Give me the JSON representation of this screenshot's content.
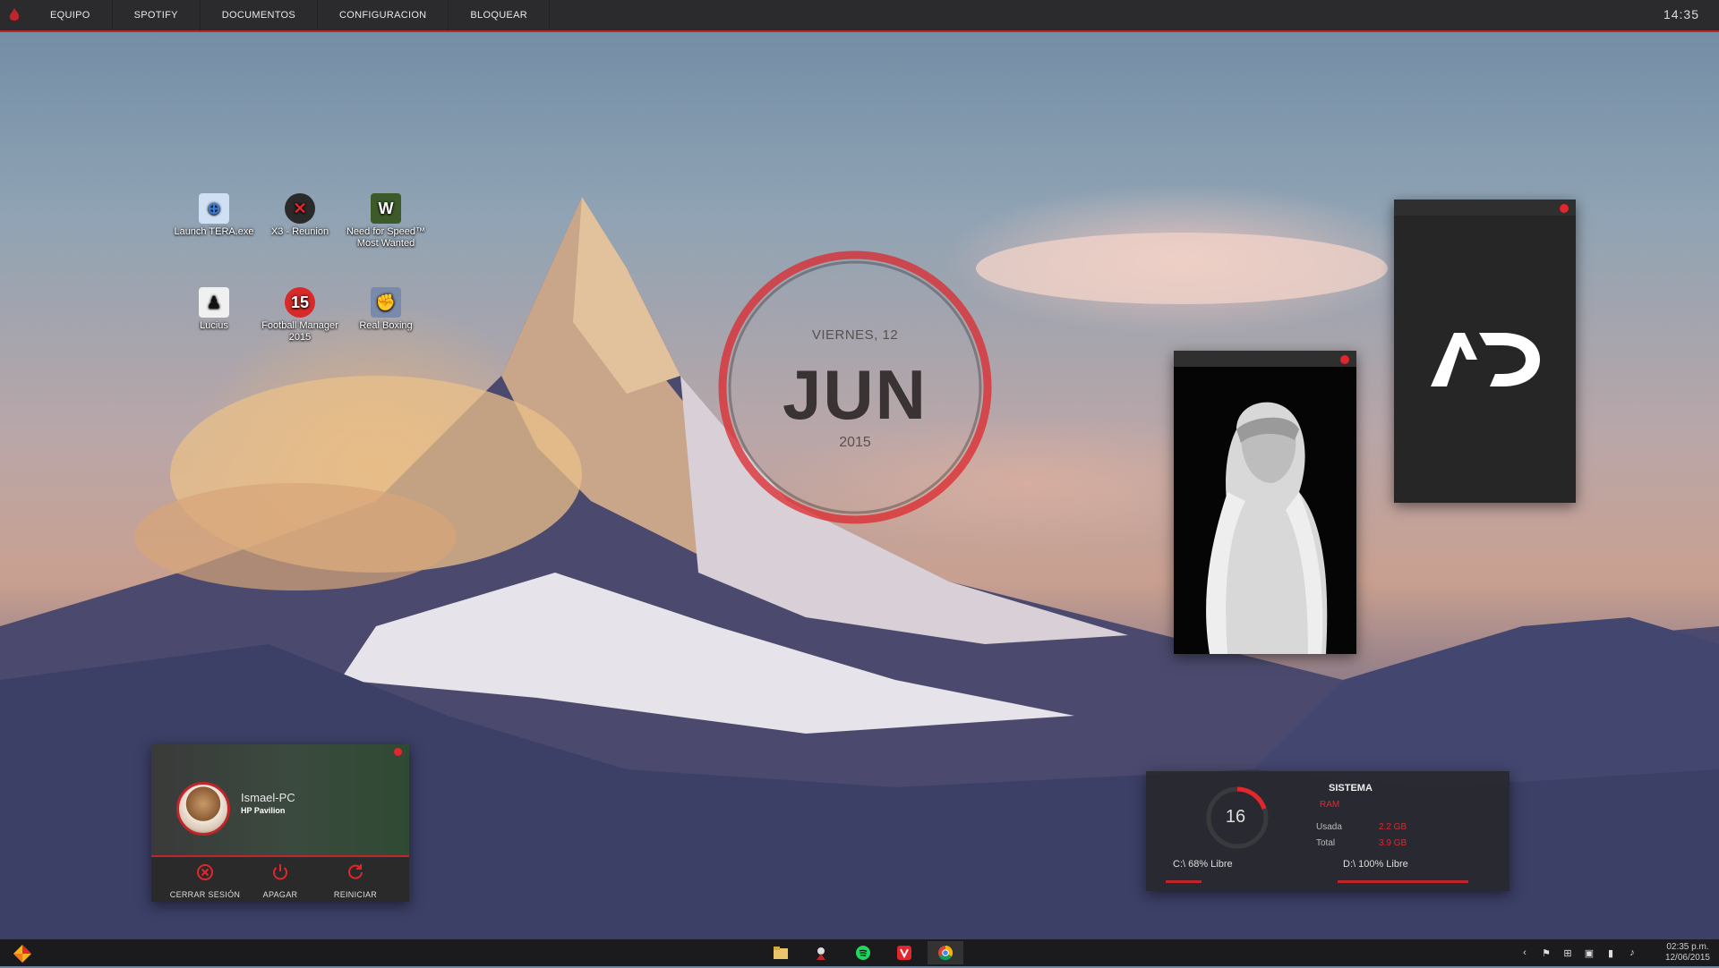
{
  "topbar": {
    "menu": [
      "EQUIPO",
      "SPOTIFY",
      "DOCUMENTOS",
      "CONFIGURACION",
      "BLOQUEAR"
    ],
    "clock": "14:35"
  },
  "desktop_icons": [
    {
      "label": "Launch TERA.exe",
      "icon": "tera-icon",
      "color": "#3a7bd5"
    },
    {
      "label": "X3 - Reunion",
      "icon": "x3-icon",
      "color": "#c0252b"
    },
    {
      "label": "Need for Speed™ Most Wanted",
      "icon": "nfs-icon",
      "color": "#3d5a2a"
    },
    {
      "label": "Lucius",
      "icon": "lucius-icon",
      "color": "#222222"
    },
    {
      "label": "Football Manager 2015",
      "icon": "fm-icon",
      "color": "#d92a2a"
    },
    {
      "label": "Real Boxing",
      "icon": "boxing-icon",
      "color": "#5a6a8a"
    }
  ],
  "date_widget": {
    "day": "VIERNES, 12",
    "month": "JUN",
    "year": "2015"
  },
  "user_widget": {
    "pc_name": "Ismael-PC",
    "model": "HP Pavilion",
    "actions": [
      "CERRAR SESIÓN",
      "APAGAR",
      "REINICIAR"
    ]
  },
  "system_widget": {
    "value": "16",
    "title": "SISTEMA",
    "section": "RAM",
    "used_label": "Usada",
    "used_value": "2.2 GB",
    "total_label": "Total",
    "total_value": "3.9 GB",
    "drive_c": "C:\\ 68% Libre",
    "drive_d": "D:\\ 100% Libre"
  },
  "taskbar": {
    "apps": [
      "file-explorer-icon",
      "media-icon",
      "spotify-icon",
      "vivaldi-icon",
      "chrome-icon"
    ],
    "time": "02:35 p.m.",
    "date": "12/06/2015"
  },
  "colors": {
    "accent": "#e2262c",
    "bar": "#2b2b2d"
  }
}
